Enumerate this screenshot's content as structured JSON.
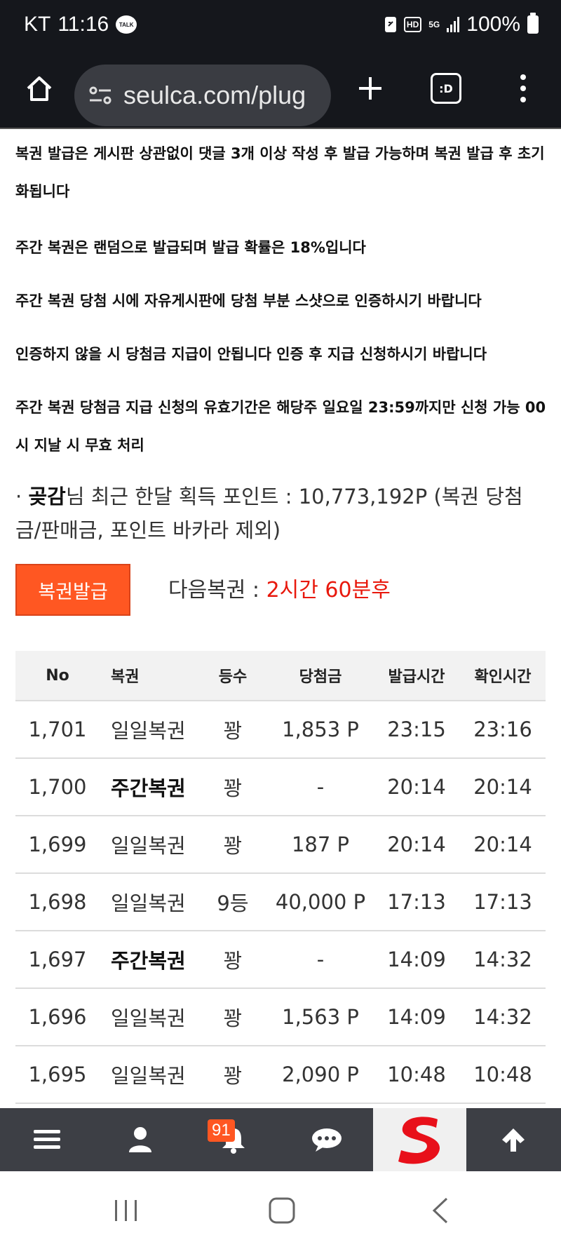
{
  "status_bar": {
    "carrier": "KT",
    "time": "11:16",
    "talk_badge": "TALK",
    "hd_label": "HD",
    "network_label": "5G",
    "battery": "100%"
  },
  "browser": {
    "url": "seulca.com/plug",
    "tabs_label": ":D"
  },
  "notices": [
    "복권 발급은 게시판 상관없이 댓글 3개 이상 작성 후 발급 가능하며 복권 발급 후 초기화됩니다",
    "주간 복권은 랜덤으로 발급되며 발급 확률은 18%입니다",
    "주간 복권 당첨 시에 자유게시판에 당첨 부분 스샷으로 인증하시기 바랍니다",
    "인증하지 않을 시 당첨금 지급이 안됩니다 인증 후 지급 신청하시기 바랍니다",
    "주간 복권 당첨금 지급 신청의 유효기간은 해당주 일요일 23:59까지만 신청 가능 00시 지날 시 무효 처리"
  ],
  "points": {
    "bullet": "·",
    "nickname": "곶감",
    "text": "님 최근 한달 획득 포인트 : 10,773,192P (복권 당첨금/판매금, 포인트 바카라 제외)"
  },
  "lottery": {
    "issue_button": "복권발급",
    "next_label": "다음복권 : ",
    "next_value": "2시간 60분후"
  },
  "table": {
    "headers": {
      "no": "No",
      "type": "복권",
      "rank": "등수",
      "prize": "당첨금",
      "issued": "발급시간",
      "checked": "확인시간"
    },
    "rows": [
      {
        "no": "1,701",
        "type": "일일복권",
        "rank": "꽝",
        "prize": "1,853 P",
        "issued": "23:15",
        "checked": "23:16"
      },
      {
        "no": "1,700",
        "type": "주간복권",
        "rank": "꽝",
        "prize": "-",
        "issued": "20:14",
        "checked": "20:14"
      },
      {
        "no": "1,699",
        "type": "일일복권",
        "rank": "꽝",
        "prize": "187 P",
        "issued": "20:14",
        "checked": "20:14"
      },
      {
        "no": "1,698",
        "type": "일일복권",
        "rank": "9등",
        "prize": "40,000 P",
        "issued": "17:13",
        "checked": "17:13"
      },
      {
        "no": "1,697",
        "type": "주간복권",
        "rank": "꽝",
        "prize": "-",
        "issued": "14:09",
        "checked": "14:32"
      },
      {
        "no": "1,696",
        "type": "일일복권",
        "rank": "꽝",
        "prize": "1,563 P",
        "issued": "14:09",
        "checked": "14:32"
      },
      {
        "no": "1,695",
        "type": "일일복권",
        "rank": "꽝",
        "prize": "2,090 P",
        "issued": "10:48",
        "checked": "10:48"
      }
    ]
  },
  "app_nav": {
    "notification_count": "91",
    "icons": [
      "menu-icon",
      "user-icon",
      "bell-icon",
      "chat-icon",
      "site-logo",
      "arrow-up-icon"
    ]
  },
  "colors": {
    "issue_button": "#ff5722",
    "next_value": "#e8180c",
    "app_nav_bg": "#3d3f45",
    "logo_red": "#e8101a"
  }
}
